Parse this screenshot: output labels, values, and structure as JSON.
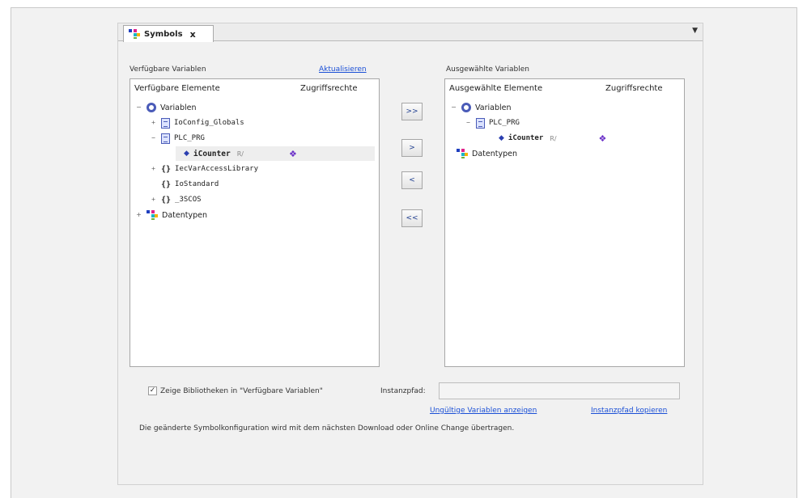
{
  "tab": {
    "title": "Symbols",
    "close": "x",
    "dropdown": "▼"
  },
  "left": {
    "title": "Verfügbare Variablen",
    "refresh_link": "Aktualisieren",
    "col_elements": "Verfügbare Elemente",
    "col_rights": "Zugriffsrechte",
    "tree": {
      "root": "Variablen",
      "io_config": "IoConfig_Globals",
      "plc_prg": "PLC_PRG",
      "icounter": "iCounter",
      "icounter_access_text": "R/",
      "iec_lib": "IecVarAccessLibrary",
      "io_standard": "IoStandard",
      "sscos": "_3SCOS",
      "datentypen": "Datentypen"
    }
  },
  "buttons": {
    "add_all": ">>",
    "add": ">",
    "remove": "<",
    "remove_all": "<<"
  },
  "right": {
    "title": "Ausgewählte Variablen",
    "col_elements": "Ausgewählte Elemente",
    "col_rights": "Zugriffsrechte",
    "tree": {
      "root": "Variablen",
      "plc_prg": "PLC_PRG",
      "icounter": "iCounter",
      "icounter_access_text": "R/",
      "datentypen": "Datentypen"
    }
  },
  "bottom": {
    "show_libs_label": "Zeige Bibliotheken in \"Verfügbare Variablen\"",
    "show_libs_checked": "✓",
    "instance_path_label": "Instanzpfad:",
    "instance_path_value": "",
    "invalid_vars_link": "Ungültige Variablen anzeigen",
    "copy_path_link": "Instanzpfad kopieren",
    "info_text": "Die geänderte Symbolkonfiguration wird mit dem nächsten Download oder Online Change übertragen."
  },
  "icons": {
    "expand": "+",
    "collapse": "−",
    "pin": "◆",
    "access": "❖"
  },
  "colors": {
    "link": "#1a4fd6",
    "accent": "#4a5bb8"
  }
}
